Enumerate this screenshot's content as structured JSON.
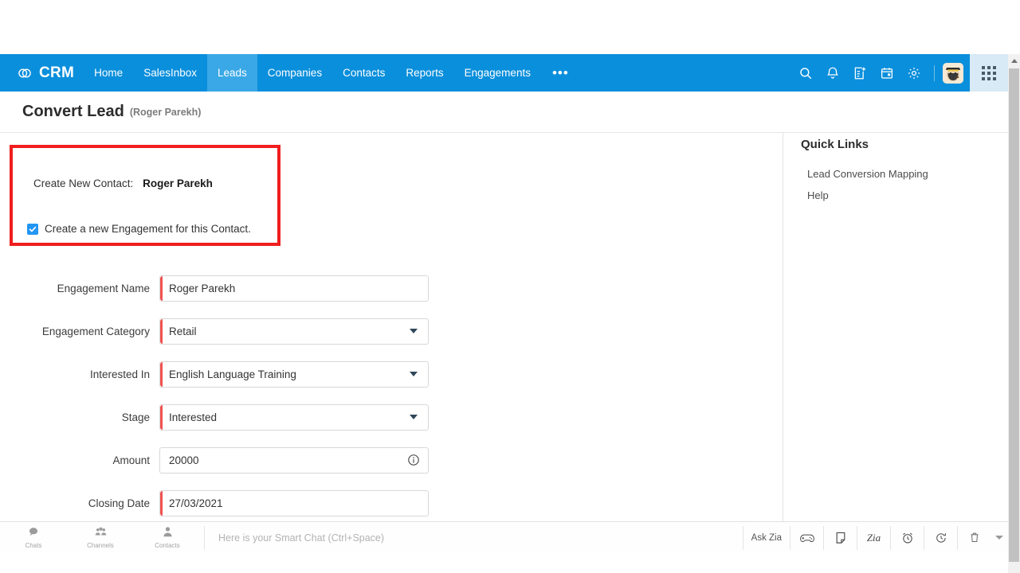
{
  "nav": {
    "brand": "CRM",
    "brand_icon": "zoho-crm-logo-icon",
    "items": [
      {
        "label": "Home",
        "active": false
      },
      {
        "label": "SalesInbox",
        "active": false
      },
      {
        "label": "Leads",
        "active": true
      },
      {
        "label": "Companies",
        "active": false
      },
      {
        "label": "Contacts",
        "active": false
      },
      {
        "label": "Reports",
        "active": false
      },
      {
        "label": "Engagements",
        "active": false
      }
    ],
    "more_label": "•••",
    "icons": [
      "search-icon",
      "notification-bell-icon",
      "add-note-icon",
      "calendar-icon",
      "settings-gear-icon"
    ],
    "avatar_alt": "user-avatar",
    "apps_label": "apps-grid-icon",
    "accent_color": "#0a8fdc",
    "active_tab_color": "#3aa8e6"
  },
  "header": {
    "title": "Convert Lead",
    "subtitle": "(Roger Parekh)"
  },
  "highlight": {
    "border_color": "#f01e1e",
    "create_contact_label": "Create New Contact:",
    "create_contact_value": "Roger Parekh",
    "checkbox_checked": true,
    "checkbox_label": "Create a new Engagement for this Contact.",
    "checkbox_color": "#2196f3"
  },
  "form": {
    "fields": [
      {
        "label": "Engagement Name",
        "value": "Roger Parekh",
        "type": "text",
        "required": true,
        "info": false
      },
      {
        "label": "Engagement Category",
        "value": "Retail",
        "type": "select",
        "required": true,
        "info": false
      },
      {
        "label": "Interested In",
        "value": "English Language Training",
        "type": "select",
        "required": true,
        "info": false
      },
      {
        "label": "Stage",
        "value": "Interested",
        "type": "select",
        "required": true,
        "info": false
      },
      {
        "label": "Amount",
        "value": "20000",
        "type": "text",
        "required": false,
        "info": true
      },
      {
        "label": "Closing Date",
        "value": "27/03/2021",
        "type": "text",
        "required": true,
        "info": false
      }
    ],
    "required_marker_color": "#ef5350"
  },
  "quick_links": {
    "title": "Quick Links",
    "links": [
      {
        "label": "Lead Conversion Mapping"
      },
      {
        "label": "Help"
      }
    ]
  },
  "bottom_bar": {
    "tabs": [
      {
        "label": "Chats",
        "icon": "chat-bubble-icon"
      },
      {
        "label": "Channels",
        "icon": "channels-group-icon"
      },
      {
        "label": "Contacts",
        "icon": "contact-person-icon"
      }
    ],
    "chat_placeholder": "Here is your Smart Chat (Ctrl+Space)",
    "right_items": [
      {
        "label": "Ask Zia",
        "icon": "ask-zia-text",
        "type": "text"
      },
      {
        "label": "",
        "icon": "game-controller-icon",
        "type": "icon"
      },
      {
        "label": "",
        "icon": "sticky-note-icon",
        "type": "icon"
      },
      {
        "label": "Zia",
        "icon": "zia-script-icon",
        "type": "script"
      },
      {
        "label": "",
        "icon": "alarm-clock-icon",
        "type": "icon"
      },
      {
        "label": "",
        "icon": "clock-history-icon",
        "type": "icon"
      },
      {
        "label": "",
        "icon": "trash-bin-icon",
        "type": "icon"
      }
    ],
    "overflow_label": "chevron-down-icon"
  }
}
